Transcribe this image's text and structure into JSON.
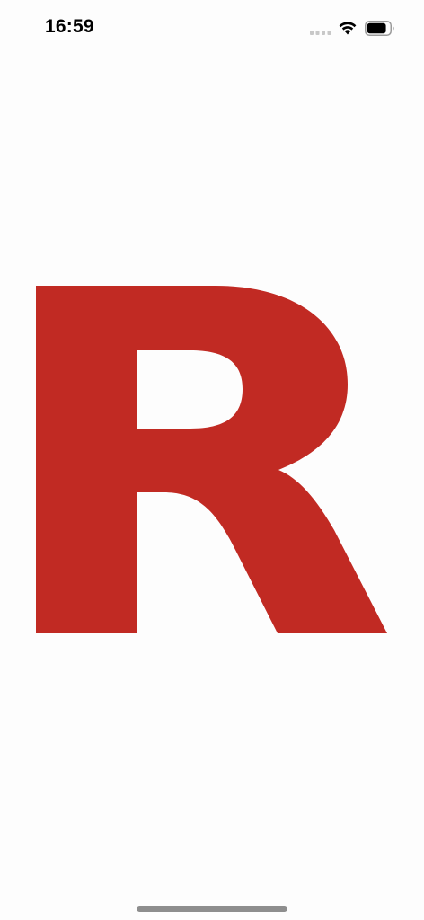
{
  "status_bar": {
    "time": "16:59",
    "signal_icon": "cellular-signal-icon",
    "wifi_icon": "wifi-icon",
    "battery_icon": "battery-icon",
    "battery_level": 0.85
  },
  "splash": {
    "logo_letter": "R",
    "logo_color": "#c12a23",
    "background_color": "#fdfdfd"
  },
  "home_indicator": {
    "icon": "home-indicator-bar"
  }
}
